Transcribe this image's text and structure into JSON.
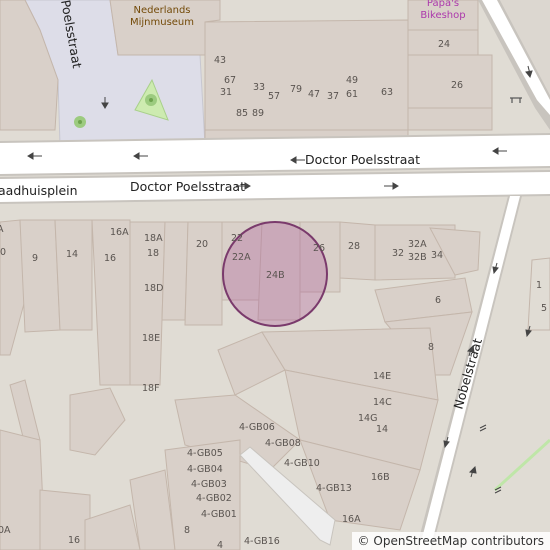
{
  "attribution": {
    "symbol": "©",
    "text": "OpenStreetMap contributors"
  },
  "streets": {
    "poelsstraat_vertical": "Poelsstraat",
    "doctor_poelsstraat_north": "Doctor Poelsstraat",
    "doctor_poelsstraat_south": "Doctor Poelsstraat",
    "raadhuisplein": "aadhuisplein",
    "nobelstraat": "Nobelstraat"
  },
  "pois": {
    "museum": [
      "Nederlands",
      "Mijnmuseum"
    ],
    "bikeshop": [
      "Papa's",
      "Bikeshop"
    ]
  },
  "house_numbers": {
    "n_43": "43",
    "n_67": "67",
    "n_31": "31",
    "n_33": "33",
    "n_57": "57",
    "n_79": "79",
    "n_47": "47",
    "n_37": "37",
    "n_49": "49",
    "n_61": "61",
    "n_63": "63",
    "n_85": "85",
    "n_89": "89",
    "n_24": "24",
    "n_26": "26",
    "s_16A": "16A",
    "s_18A": "18A",
    "s_18": "18",
    "s_16": "16",
    "s_14": "14",
    "s_9": "9",
    "s_0": "0",
    "s_A": "A",
    "s_20": "20",
    "s_22": "22",
    "s_22A": "22A",
    "s_24B": "24B",
    "s_26": "26",
    "s_28": "28",
    "s_32": "32",
    "s_32A": "32A",
    "s_32B": "32B",
    "s_34": "34",
    "s_18D": "18D",
    "s_18E": "18E",
    "s_18F": "18F",
    "s_6": "6",
    "s_8": "8",
    "s_1": "1",
    "s_5": "5",
    "s_14E": "14E",
    "s_14C": "14C",
    "s_14G": "14G",
    "s_14b": "14",
    "gb06": "4-GB06",
    "gb08": "4-GB08",
    "gb05": "4-GB05",
    "gb04": "4-GB04",
    "gb03": "4-GB03",
    "gb10": "4-GB10",
    "gb02": "4-GB02",
    "gb13": "4-GB13",
    "gb01": "4-GB01",
    "gb16": "4-GB16",
    "s_16B": "16B",
    "s_16Ab": "16A",
    "s_8b": "8",
    "s_4": "4",
    "s_0A": "0A",
    "s_16c": "16"
  },
  "colors": {
    "background": "#e0dcd4",
    "building": "#d9d0c9",
    "building_stroke": "#c4b6ab",
    "road": "#ffffff",
    "road_casing": "#c8c4be",
    "pedestrian": "#dddde8",
    "grass": "#cdebb0",
    "highlight_fill": "#b0609a",
    "highlight_stroke": "#7a3a6c",
    "museum_text": "#734a08",
    "bikeshop_text": "#ac39ac"
  },
  "icons": [
    "one-way-arrow-icon",
    "park-tree-icon",
    "bicycle-parking-icon",
    "bench-icon",
    "railway-crossing-icon"
  ]
}
